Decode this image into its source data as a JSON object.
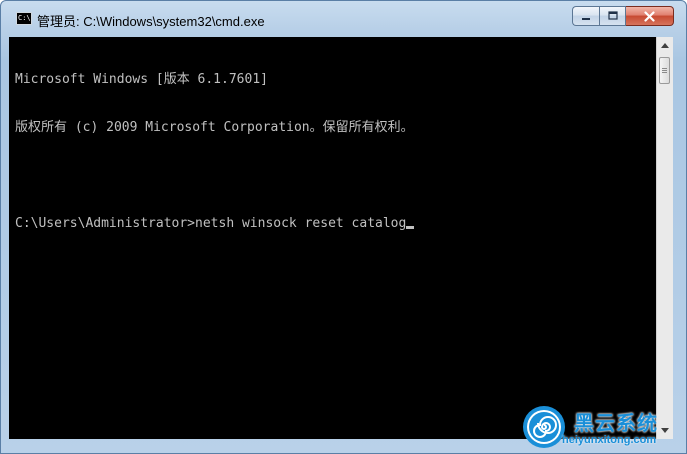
{
  "window": {
    "title": "管理员: C:\\Windows\\system32\\cmd.exe",
    "icon": "cmd-icon",
    "icon_label": "C:\\",
    "buttons": {
      "minimize": "minimize-icon",
      "maximize": "maximize-icon",
      "close": "close-icon"
    }
  },
  "console": {
    "lines": [
      "Microsoft Windows [版本 6.1.7601]",
      "版权所有 (c) 2009 Microsoft Corporation。保留所有权利。",
      "",
      "C:\\Users\\Administrator>netsh winsock reset catalog"
    ],
    "text_color": "#c0c0c0",
    "background": "#000000"
  },
  "scrollbar": {
    "up": "scroll-up-arrow-icon",
    "down": "scroll-down-arrow-icon"
  },
  "watermark": {
    "title": "黑云系统",
    "url": "heiyunxitong.com",
    "logo": "spiral-logo-icon",
    "color": "#1a8fd8"
  }
}
